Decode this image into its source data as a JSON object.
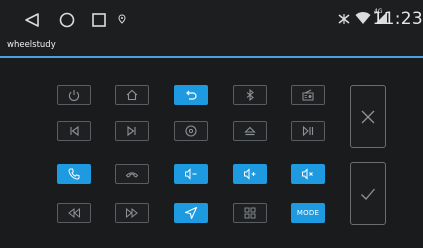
{
  "status_bar": {
    "nav_icons": [
      "back-triangle-icon",
      "home-circle-icon",
      "recents-square-icon"
    ],
    "notification_icon": "location-pin-icon",
    "status_icons": [
      "bluetooth-off-icon",
      "wifi-icon",
      "signal-4g-icon"
    ],
    "network_type": "4G",
    "time": "11:23"
  },
  "app": {
    "title": "wheelstudy"
  },
  "colors": {
    "accent": "#1e9ae0",
    "divider": "#4aa3df",
    "background": "#1b1c1e"
  },
  "keypad": {
    "rows": [
      [
        {
          "icon": "power-icon",
          "active": false
        },
        {
          "icon": "home-icon",
          "active": false
        },
        {
          "icon": "back-return-icon",
          "active": true
        },
        {
          "icon": "bluetooth-icon",
          "active": false
        },
        {
          "icon": "radio-icon",
          "active": false
        }
      ],
      [
        {
          "icon": "skip-previous-icon",
          "active": false
        },
        {
          "icon": "skip-next-icon",
          "active": false
        },
        {
          "icon": "disc-icon",
          "active": false
        },
        {
          "icon": "eject-icon",
          "active": false
        },
        {
          "icon": "play-pause-icon",
          "active": false
        }
      ],
      [
        {
          "icon": "phone-icon",
          "active": true
        },
        {
          "icon": "hang-up-icon",
          "active": false
        },
        {
          "icon": "volume-down-icon",
          "active": true
        },
        {
          "icon": "volume-up-icon",
          "active": true
        },
        {
          "icon": "mute-icon",
          "active": true
        }
      ],
      [
        {
          "icon": "rewind-icon",
          "active": false
        },
        {
          "icon": "fast-forward-icon",
          "active": false
        },
        {
          "icon": "navigation-icon",
          "active": true
        },
        {
          "icon": "apps-icon",
          "active": false
        },
        {
          "icon": "mode-button",
          "label": "MODE",
          "active": true
        }
      ]
    ],
    "side_buttons": [
      {
        "icon": "close-icon"
      },
      {
        "icon": "check-icon"
      }
    ]
  }
}
